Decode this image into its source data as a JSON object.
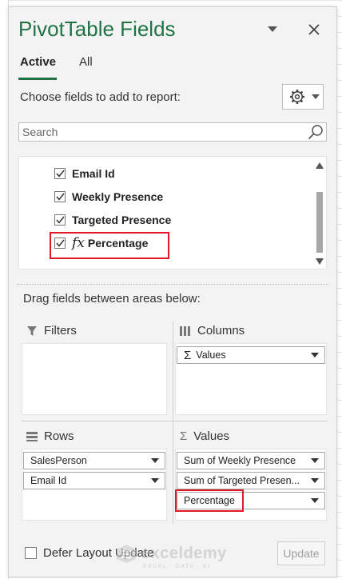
{
  "pane": {
    "title": "PivotTable Fields",
    "tabs": [
      {
        "label": "Active",
        "active": true
      },
      {
        "label": "All",
        "active": false
      }
    ],
    "choose_label": "Choose fields to add to report:",
    "search": {
      "placeholder": "Search",
      "value": ""
    },
    "fields": [
      {
        "label": "Email Id",
        "checked": true,
        "calculated": false
      },
      {
        "label": "Weekly Presence",
        "checked": true,
        "calculated": false
      },
      {
        "label": "Targeted Presence",
        "checked": true,
        "calculated": false
      },
      {
        "label": "Percentage",
        "checked": true,
        "calculated": true,
        "prefix": "fx"
      }
    ],
    "drag_label": "Drag fields between areas below:",
    "areas": {
      "filters": {
        "title": "Filters",
        "items": []
      },
      "columns": {
        "title": "Columns",
        "items": [
          {
            "label": "Values",
            "prefix": "Σ"
          }
        ]
      },
      "rows": {
        "title": "Rows",
        "items": [
          {
            "label": "SalesPerson"
          },
          {
            "label": "Email Id"
          }
        ]
      },
      "values": {
        "title": "Values",
        "items": [
          {
            "label": "Sum of Weekly Presence"
          },
          {
            "label": "Sum of Targeted Presen..."
          },
          {
            "label": "Percentage"
          }
        ]
      }
    },
    "defer_label": "Defer Layout Update",
    "defer_checked": false,
    "update_label": "Update"
  },
  "watermark": {
    "name": "exceldemy",
    "tagline": "EXCEL · DATA · BI"
  },
  "colors": {
    "accent": "#217346",
    "highlight": "#e0182a",
    "pane_bg": "#f3f3f3"
  }
}
